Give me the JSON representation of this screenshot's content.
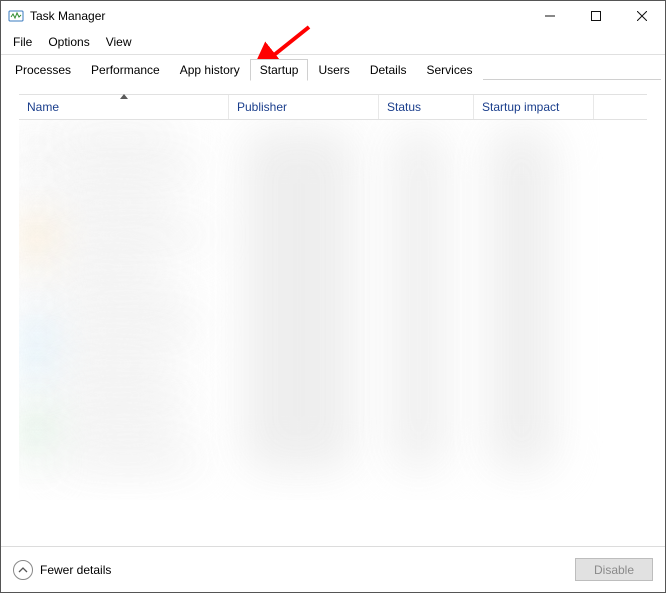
{
  "window": {
    "title": "Task Manager"
  },
  "menu": {
    "file": "File",
    "options": "Options",
    "view": "View"
  },
  "tabs": {
    "processes": "Processes",
    "performance": "Performance",
    "app_history": "App history",
    "startup": "Startup",
    "users": "Users",
    "details": "Details",
    "services": "Services",
    "active": "startup"
  },
  "columns": {
    "name": "Name",
    "publisher": "Publisher",
    "status": "Status",
    "impact": "Startup impact",
    "sort_column": "name",
    "sort_direction": "ascending"
  },
  "footer": {
    "fewer_details": "Fewer details",
    "disable": "Disable",
    "disable_enabled": false
  },
  "annotation": {
    "arrow_target": "tab-startup",
    "arrow_color": "#ff0000"
  }
}
